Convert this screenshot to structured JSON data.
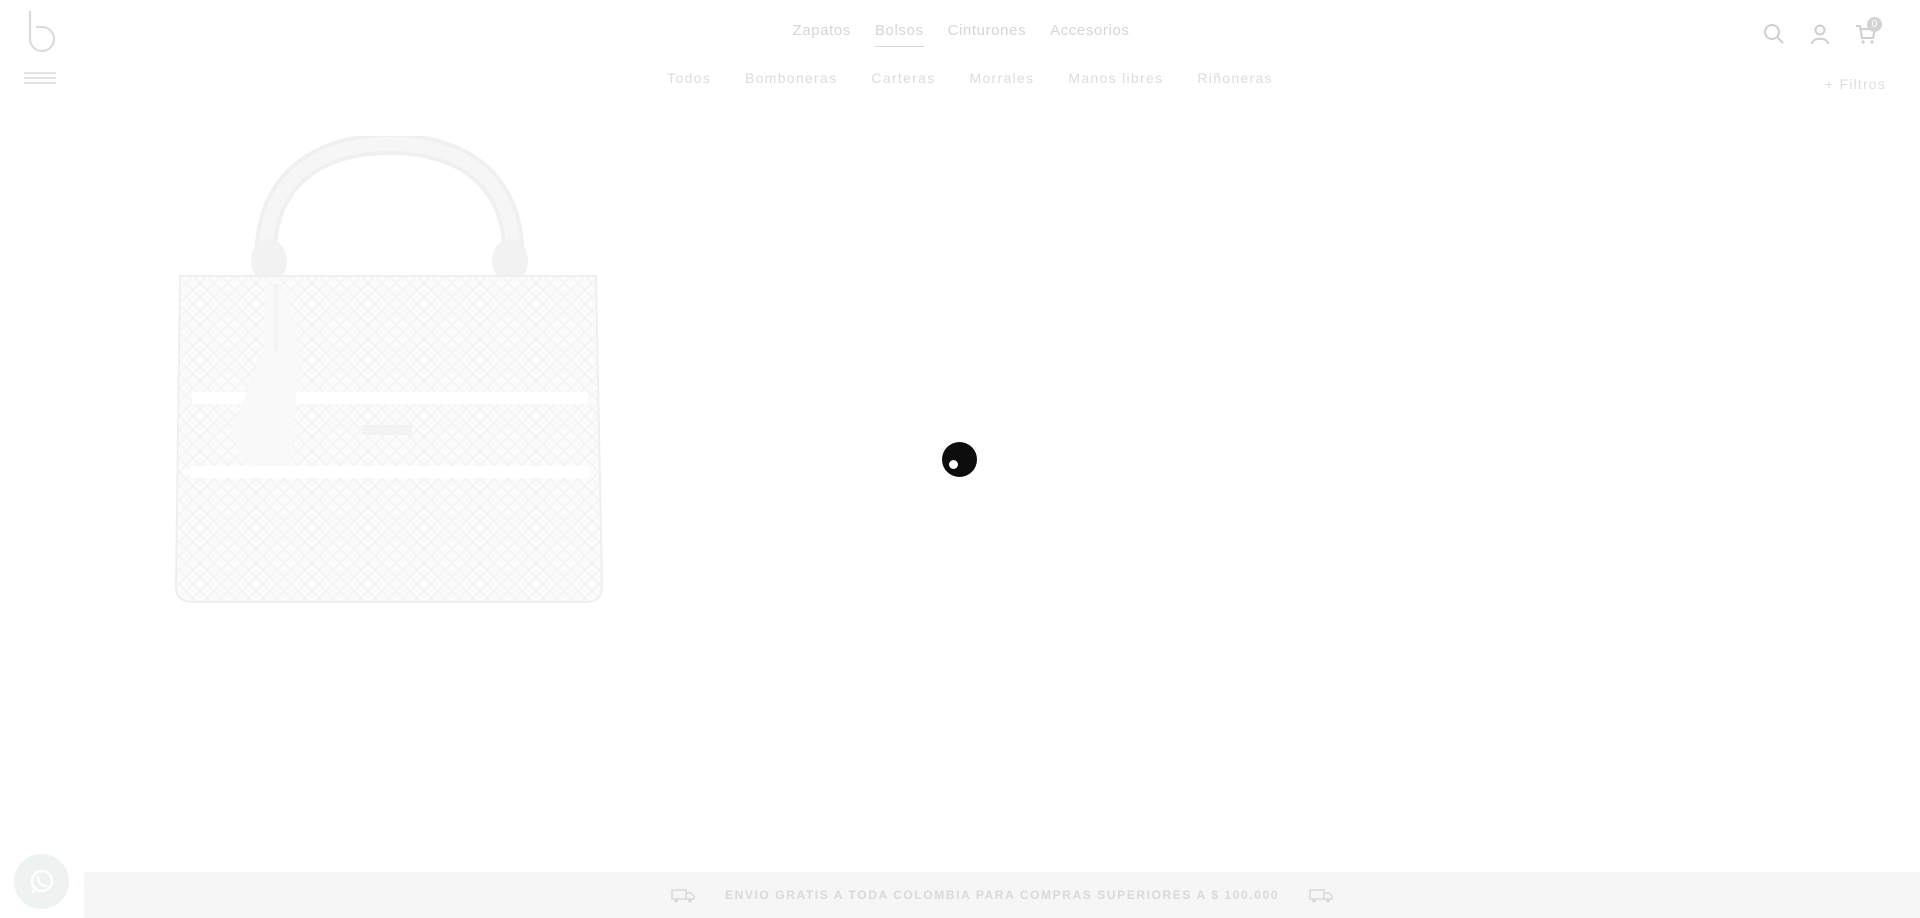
{
  "header": {
    "logo_alt": "b",
    "main_nav": [
      {
        "label": "Zapatos",
        "active": false
      },
      {
        "label": "Bolsos",
        "active": true
      },
      {
        "label": "Cinturones",
        "active": false
      },
      {
        "label": "Accesorios",
        "active": false
      }
    ],
    "cart_count": "0",
    "icons": [
      "search-icon",
      "user-icon",
      "cart-icon"
    ]
  },
  "sub_nav": [
    {
      "label": "Todos"
    },
    {
      "label": "Bomboneras"
    },
    {
      "label": "Carteras"
    },
    {
      "label": "Morrales"
    },
    {
      "label": "Manos libres"
    },
    {
      "label": "Riñoneras"
    }
  ],
  "filters": {
    "label": "+ Filtros"
  },
  "product": {
    "image_icon": "tote-bag-image"
  },
  "loading": {
    "icon": "loading-spinner-icon"
  },
  "promo": {
    "text": "ENVIO GRATIS A TODA COLOMBIA PARA COMPRAS SUPERIORES A $ 100.000",
    "icon": "truck-icon"
  },
  "whatsapp": {
    "icon": "whatsapp-icon"
  },
  "colors": {
    "faded_text": "#d6d6d6",
    "spinner": "#0d0d0d",
    "promo_bg": "#f6f6f6"
  }
}
